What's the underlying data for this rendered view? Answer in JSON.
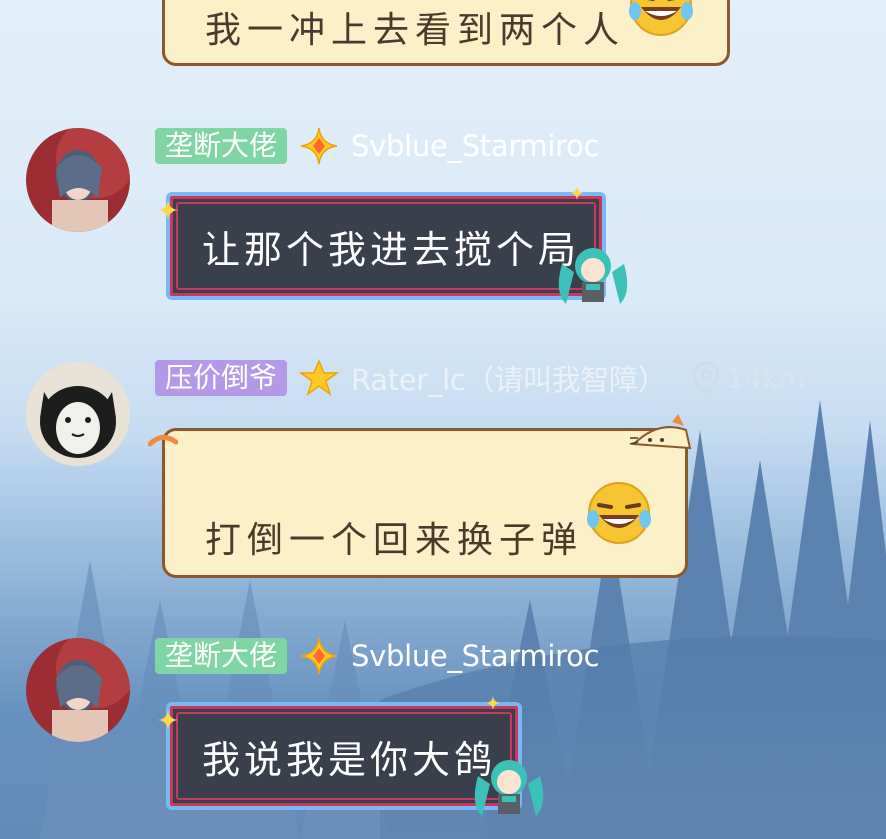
{
  "messages": [
    {
      "id": "m0",
      "text": "我一冲上去看到两个人",
      "bubble_style": "scroll",
      "emoji": "laughing-tears"
    },
    {
      "id": "m1",
      "tag": "垄断大佬",
      "tag_color": "#7fd6a4",
      "badge": "gold-diamond",
      "nickname": "Svblue_Starmiroc",
      "text": "让那个我进去搅个局",
      "bubble_style": "dark-frame",
      "sticker": "miku"
    },
    {
      "id": "m2",
      "tag": "压价倒爷",
      "tag_color": "#b399e8",
      "badge": "gold-star",
      "nickname": "Rater_lc（请叫我智障）",
      "location": "14km",
      "text": "打倒一个回来换子弹",
      "bubble_style": "scroll-cat",
      "emoji": "laughing-tears"
    },
    {
      "id": "m3",
      "tag": "垄断大佬",
      "tag_color": "#7fd6a4",
      "badge": "gold-diamond",
      "nickname": "Svblue_Starmiroc",
      "text": "我说我是你大鸽",
      "bubble_style": "dark-frame",
      "sticker": "miku"
    }
  ],
  "theme": {
    "scroll_fill": "#fbf0c7",
    "scroll_border": "#8a5a2e",
    "dark_fill": "#3a3f4c",
    "frame_blue": "#7bb7f2",
    "frame_red": "#c9385f"
  }
}
